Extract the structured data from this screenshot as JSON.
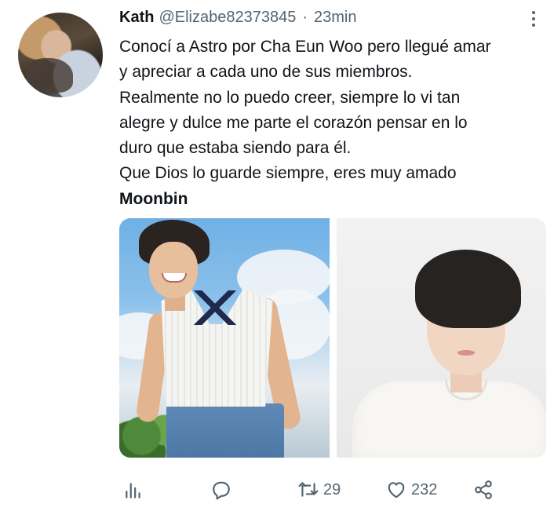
{
  "tweet": {
    "author": {
      "name": "Kath",
      "handle": "@Elizabe82373845",
      "separator": "·",
      "time": "23min"
    },
    "text_lines": [
      "Conocí a Astro por Cha Eun Woo pero llegué amar",
      "y apreciar a cada uno de sus miembros.",
      "Realmente no lo puedo creer, siempre lo vi tan",
      "alegre y dulce me parte el corazón pensar en lo",
      "duro que estaba siendo para él.",
      "Que Dios lo guarde siempre, eres muy amado",
      "Moonbin"
    ],
    "actions": {
      "analytics_icon": "bar-chart-icon",
      "reply_icon": "speech-bubble-icon",
      "retweet_icon": "retweet-arrows-icon",
      "retweet_count": "29",
      "like_icon": "heart-icon",
      "like_count": "232",
      "share_icon": "share-nodes-icon"
    },
    "more_icon": "vertical-dots-icon"
  },
  "colors": {
    "text_primary": "#0f1419",
    "text_secondary": "#536471",
    "background": "#ffffff"
  }
}
